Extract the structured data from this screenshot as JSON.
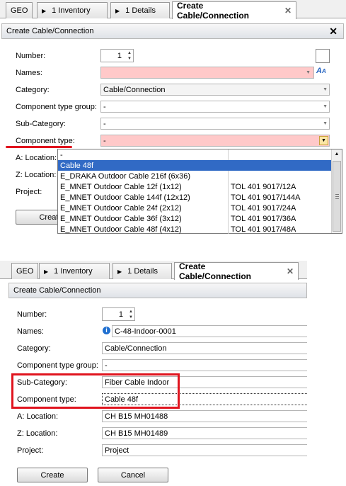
{
  "top": {
    "tabs": [
      "GEO",
      "1 Inventory",
      "1 Details",
      "Create Cable/Connection"
    ],
    "dialog_title": "Create Cable/Connection",
    "labels": {
      "number": "Number:",
      "names": "Names:",
      "category": "Category:",
      "component_type_group": "Component type group:",
      "sub_category": "Sub-Category:",
      "component_type": "Component type:",
      "a_location": "A: Location:",
      "z_location": "Z: Location:",
      "project": "Project:"
    },
    "values": {
      "number": "1",
      "names": "",
      "category": "Cable/Connection",
      "component_type_group": "-",
      "sub_category": "-",
      "component_type": "-"
    },
    "create_button": "Create",
    "dropdown": [
      {
        "name": "-",
        "code": ""
      },
      {
        "name": "Cable 48f",
        "code": "",
        "selected": true
      },
      {
        "name": "E_DRAKA Outdoor Cable 216f (6x36)",
        "code": ""
      },
      {
        "name": "E_MNET Outdoor Cable 12f (1x12)",
        "code": "TOL 401 9017/12A"
      },
      {
        "name": "E_MNET Outdoor Cable 144f (12x12)",
        "code": "TOL 401 9017/144A"
      },
      {
        "name": "E_MNET Outdoor Cable 24f (2x12)",
        "code": "TOL 401 9017/24A"
      },
      {
        "name": "E_MNET Outdoor Cable 36f (3x12)",
        "code": "TOL 401 9017/36A"
      },
      {
        "name": "E_MNET Outdoor Cable 48f (4x12)",
        "code": "TOL 401 9017/48A"
      }
    ]
  },
  "bottom": {
    "tabs": [
      "GEO",
      "1 Inventory",
      "1 Details",
      "Create Cable/Connection"
    ],
    "dialog_title": "Create Cable/Connection",
    "labels": {
      "number": "Number:",
      "names": "Names:",
      "category": "Category:",
      "component_type_group": "Component type group:",
      "sub_category": "Sub-Category:",
      "component_type": "Component type:",
      "a_location": "A: Location:",
      "z_location": "Z: Location:",
      "project": "Project:"
    },
    "values": {
      "number": "1",
      "names": "C-48-Indoor-0001",
      "category": "Cable/Connection",
      "component_type_group": "-",
      "sub_category": "Fiber Cable Indoor",
      "component_type": "Cable 48f",
      "a_location": "CH B15 MH01488",
      "z_location": "CH B15 MH01489",
      "project": "Project"
    },
    "create_button": "Create",
    "cancel_button": "Cancel"
  },
  "colors": {
    "highlight_red": "#e0141e",
    "required_pink": "#ffc9c9",
    "selection_blue": "#316ac5"
  }
}
